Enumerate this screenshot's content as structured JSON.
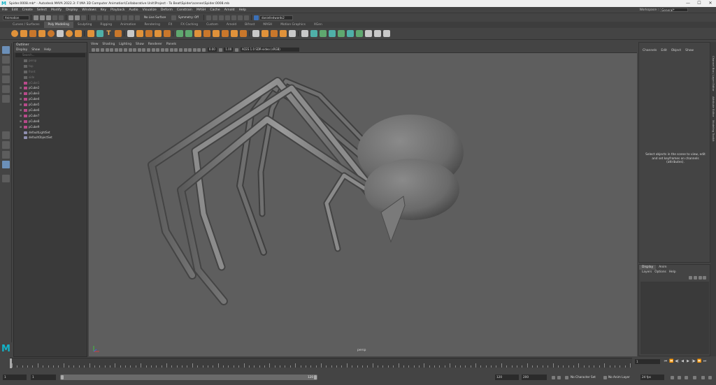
{
  "titlebar": {
    "title": "Spider.0008.mb* - Autodesk MAYA 2022.3: F:\\MA 3D Computer Animation\\Collaborative Unit\\Project - To Beat\\Spider\\scenes\\Spider.0008.mb",
    "minimize": "—",
    "maximize": "☐",
    "close": "✕"
  },
  "menubar": {
    "items": [
      "File",
      "Edit",
      "Create",
      "Select",
      "Modify",
      "Display",
      "Windows",
      "Key",
      "Playback",
      "Audio",
      "Visualize",
      "Deform",
      "Constrain",
      "MASH",
      "Cache",
      "Arnold",
      "Help"
    ],
    "workspace_label": "Workspace :",
    "workspace_value": "General*"
  },
  "statusline": {
    "mode": "Animation",
    "live_surface": "No Live Surface",
    "symmetry": "Symmetry: Off",
    "user": "danielledwards2"
  },
  "shelf": {
    "tabs": [
      "Curves / Surfaces",
      "Poly Modeling",
      "Sculpting",
      "Rigging",
      "Animation",
      "Rendering",
      "FX",
      "FX Caching",
      "Custom",
      "Arnold",
      "Bifrost",
      "MASH",
      "Motion Graphics",
      "XGen"
    ],
    "active_tab": "Poly Modeling"
  },
  "outliner": {
    "title": "Outliner",
    "menu": [
      "Display",
      "Show",
      "Help"
    ],
    "search_placeholder": "Search...",
    "items": [
      {
        "name": "persp",
        "dim": true,
        "expandable": false,
        "kind": "cam"
      },
      {
        "name": "top",
        "dim": true,
        "expandable": false,
        "kind": "cam"
      },
      {
        "name": "front",
        "dim": true,
        "expandable": false,
        "kind": "cam"
      },
      {
        "name": "side",
        "dim": true,
        "expandable": false,
        "kind": "cam"
      },
      {
        "name": "pCube1",
        "dim": true,
        "expandable": false,
        "kind": "cube"
      },
      {
        "name": "pCube2",
        "dim": false,
        "expandable": true,
        "kind": "cube"
      },
      {
        "name": "pCube3",
        "dim": false,
        "expandable": true,
        "kind": "cube"
      },
      {
        "name": "pCube4",
        "dim": false,
        "expandable": true,
        "kind": "cube"
      },
      {
        "name": "pCube5",
        "dim": false,
        "expandable": true,
        "kind": "cube"
      },
      {
        "name": "pCube6",
        "dim": false,
        "expandable": true,
        "kind": "cube"
      },
      {
        "name": "pCube7",
        "dim": false,
        "expandable": true,
        "kind": "cube"
      },
      {
        "name": "pCube8",
        "dim": false,
        "expandable": true,
        "kind": "cube"
      },
      {
        "name": "pCube9",
        "dim": false,
        "expandable": true,
        "kind": "cube"
      },
      {
        "name": "defaultLightSet",
        "dim": false,
        "expandable": false,
        "kind": "set"
      },
      {
        "name": "defaultObjectSet",
        "dim": false,
        "expandable": false,
        "kind": "set"
      }
    ]
  },
  "viewport": {
    "menu": [
      "View",
      "Shading",
      "Lighting",
      "Show",
      "Renderer",
      "Panels"
    ],
    "exposure": "0.00",
    "gamma": "1.00",
    "color_space": "ACES 1.0 SDR-video (sRGB)",
    "camera": "persp"
  },
  "channelbox": {
    "menu": [
      "Channels",
      "Edit",
      "Object",
      "Show"
    ],
    "message": "Select objects in the scene to view, edit and set keyframes on channels (attributes)."
  },
  "sidetabs": [
    "Channel Box / Layer Editor",
    "Attribute Editor",
    "Modeling Toolkit"
  ],
  "layers": {
    "tabs": [
      "Display",
      "Anim"
    ],
    "menu": [
      "Layers",
      "Options",
      "Help"
    ]
  },
  "timeslider": {
    "current_frame": "1",
    "playback_buttons": [
      "⏮",
      "⏪",
      "◀|",
      "◀",
      "▶",
      "|▶",
      "⏩",
      "⏭"
    ]
  },
  "rangeslider": {
    "start": "1",
    "playback_start": "1",
    "range_end_label": "120",
    "playback_end": "120",
    "end": "200",
    "character_set": "No Character Set",
    "anim_layer": "No Anim Layer",
    "fps": "24 fps"
  },
  "colors": {
    "maya_logo": "#12b3c8",
    "viewport_bg": "#5e5e5e",
    "shelf_orange": "#e0923a"
  }
}
